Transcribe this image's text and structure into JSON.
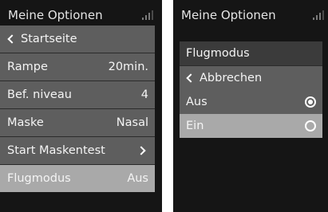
{
  "left_screen": {
    "title": "Meine Optionen",
    "back_label": "Startseite",
    "items": [
      {
        "label": "Rampe",
        "value": "20min."
      },
      {
        "label": "Bef. niveau",
        "value": "4"
      },
      {
        "label": "Maske",
        "value": "Nasal"
      },
      {
        "label": "Start Maskentest",
        "value": ""
      },
      {
        "label": "Flugmodus",
        "value": "Aus"
      }
    ],
    "selected_item": "Flugmodus"
  },
  "right_screen": {
    "title": "Meine Optionen",
    "header": "Flugmodus",
    "back_label": "Abbrechen",
    "options": [
      {
        "label": "Aus",
        "checked": true
      },
      {
        "label": "Ein",
        "checked": false
      }
    ],
    "highlighted_option": "Ein"
  },
  "icons": {
    "signal": "signal-strength-icon",
    "back": "chevron-left-icon",
    "forward": "chevron-right-icon",
    "radio_checked": "radio-checked-icon",
    "radio_unchecked": "radio-unchecked-icon"
  },
  "colors": {
    "screen_bg": "#151515",
    "row_bg": "#5e5e5e",
    "row_selected_bg": "#a9a9a9",
    "header_bg": "#3b3b3b",
    "text": "#f4f4f4"
  }
}
